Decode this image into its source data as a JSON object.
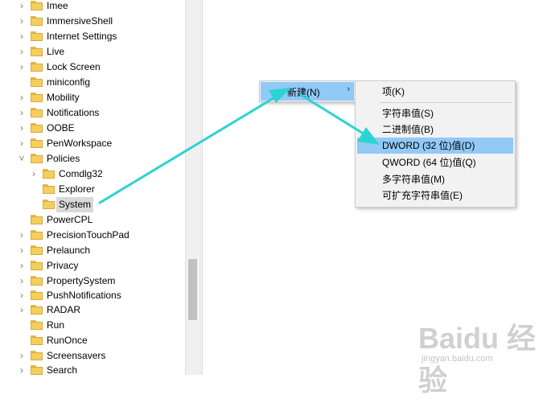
{
  "tree": {
    "items": [
      {
        "label": "Imee",
        "chevron": "›"
      },
      {
        "label": "ImmersiveShell",
        "chevron": "›"
      },
      {
        "label": "Internet Settings",
        "chevron": "›"
      },
      {
        "label": "Live",
        "chevron": "›"
      },
      {
        "label": "Lock Screen",
        "chevron": "›"
      },
      {
        "label": "miniconfig",
        "chevron": ""
      },
      {
        "label": "Mobility",
        "chevron": "›"
      },
      {
        "label": "Notifications",
        "chevron": "›"
      },
      {
        "label": "OOBE",
        "chevron": "›"
      },
      {
        "label": "PenWorkspace",
        "chevron": "›"
      },
      {
        "label": "Policies",
        "chevron": "˅"
      },
      {
        "label": "Comdlg32",
        "chevron": "›"
      },
      {
        "label": "Explorer",
        "chevron": ""
      },
      {
        "label": "System",
        "chevron": ""
      },
      {
        "label": "PowerCPL",
        "chevron": ""
      },
      {
        "label": "PrecisionTouchPad",
        "chevron": "›"
      },
      {
        "label": "Prelaunch",
        "chevron": "›"
      },
      {
        "label": "Privacy",
        "chevron": "›"
      },
      {
        "label": "PropertySystem",
        "chevron": "›"
      },
      {
        "label": "PushNotifications",
        "chevron": "›"
      },
      {
        "label": "RADAR",
        "chevron": "›"
      },
      {
        "label": "Run",
        "chevron": ""
      },
      {
        "label": "RunOnce",
        "chevron": ""
      },
      {
        "label": "Screensavers",
        "chevron": "›"
      },
      {
        "label": "Search",
        "chevron": "›"
      }
    ],
    "selected_item": "System"
  },
  "context_menu": {
    "new_label": "新建(N)",
    "submenu_arrow": "›"
  },
  "submenu": {
    "key": "项(K)",
    "string": "字符串值(S)",
    "binary": "二进制值(B)",
    "dword": "DWORD (32 位)值(D)",
    "qword": "QWORD (64 位)值(Q)",
    "multi_string": "多字符串值(M)",
    "expandable_string": "可扩充字符串值(E)",
    "highlighted": "DWORD (32 位)值(D)"
  },
  "annotation_arrow_color": "#2dd3d3",
  "watermark": {
    "text": "Baidu 经验",
    "url_text": "jingyan.baidu.com"
  }
}
